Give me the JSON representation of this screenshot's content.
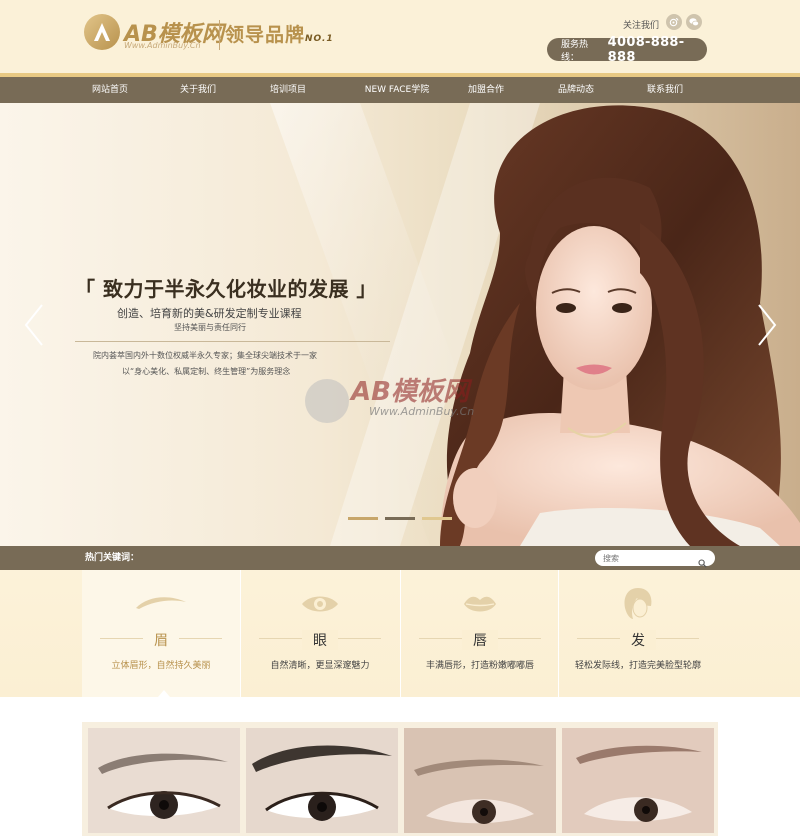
{
  "brand": {
    "logo_name": "AB模板网",
    "logo_url": "Www.AdminBuy.Cn",
    "slogan": "领导品牌",
    "slogan_suffix": "NO.1"
  },
  "header": {
    "follow_label": "关注我们",
    "hotline_label": "服务热线：",
    "hotline_number": "4008-888-888"
  },
  "nav": {
    "items": [
      {
        "label": "网站首页"
      },
      {
        "label": "关于我们"
      },
      {
        "label": "培训项目"
      },
      {
        "label": "NEW FACE学院"
      },
      {
        "label": "加盟合作"
      },
      {
        "label": "品牌动态"
      },
      {
        "label": "联系我们"
      }
    ]
  },
  "banner": {
    "title": "「 致力于半永久化妆业的发展 」",
    "subtitle": "创造、培育新的美&研发定制专业课程",
    "subtitle2": "坚持美丽与责任同行",
    "para1": "院内荟萃国内外十数位权威半永久专家；集全球尖端技术于一家",
    "para2": "以“身心美化、私属定制、终生管理”为服务理念",
    "watermark_name": "AB模板网",
    "watermark_url": "Www.AdminBuy.Cn"
  },
  "keywords": {
    "label": "热门关键词：",
    "search_placeholder": "搜索"
  },
  "features": [
    {
      "title": "眉",
      "desc": "立体眉形，自然持久美丽",
      "icon": "eyebrow-icon",
      "active": true
    },
    {
      "title": "眼",
      "desc": "自然清晰，更显深邃魅力",
      "icon": "eye-icon",
      "active": false
    },
    {
      "title": "唇",
      "desc": "丰满唇形，打造粉嫩嘟嘟唇",
      "icon": "lips-icon",
      "active": false
    },
    {
      "title": "发",
      "desc": "轻松发际线，打造完美脸型轮廓",
      "icon": "hair-icon",
      "active": false
    }
  ],
  "colors": {
    "header_bg": "#fbf1d8",
    "nav_bg": "#786b56",
    "accent_gold": "#b8924d",
    "stripe_gold": "#e8c983"
  }
}
